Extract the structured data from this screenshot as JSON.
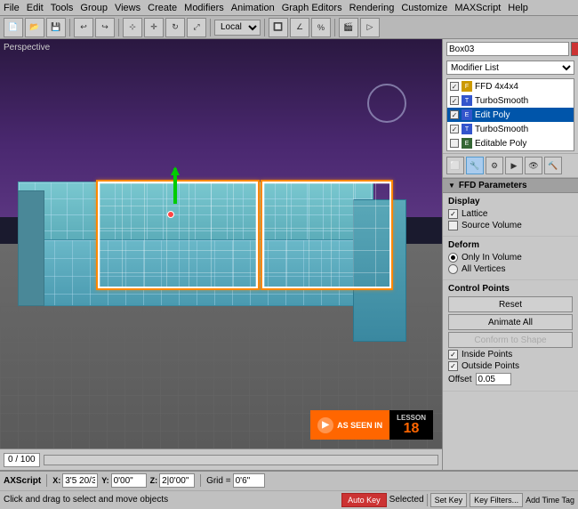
{
  "menu": {
    "items": [
      "File",
      "Edit",
      "Tools",
      "Group",
      "Views",
      "Create",
      "Modifiers",
      "Animation",
      "Graph Editors",
      "Rendering",
      "Customize",
      "MAXScript",
      "Help"
    ]
  },
  "viewport": {
    "label": "Perspective"
  },
  "right_panel": {
    "obj_name": "Box03",
    "modifier_list_label": "Modifier List",
    "stack_items": [
      {
        "name": "FFD 4x4x4",
        "type": "yellow",
        "checked": true,
        "selected": false
      },
      {
        "name": "TurboSmooth",
        "type": "blue",
        "checked": true,
        "selected": false
      },
      {
        "name": "Edit Poly",
        "type": "blue",
        "checked": true,
        "selected": true
      },
      {
        "name": "TurboSmooth",
        "type": "blue",
        "checked": true,
        "selected": false
      },
      {
        "name": "Editable Poly",
        "type": "green",
        "checked": false,
        "selected": false
      }
    ],
    "ffd_params": {
      "title": "FFD Parameters",
      "display_label": "Display",
      "lattice_label": "Lattice",
      "lattice_checked": true,
      "source_volume_label": "Source Volume",
      "source_volume_checked": false,
      "deform_label": "Deform",
      "only_in_volume_label": "Only In Volume",
      "only_in_volume_checked": true,
      "all_vertices_label": "All Vertices",
      "all_vertices_checked": false,
      "control_points_label": "Control Points",
      "reset_label": "Reset",
      "animate_all_label": "Animate All",
      "conform_label": "Conform to Shape",
      "inside_points_label": "Inside Points",
      "inside_points_checked": true,
      "outside_points_label": "Outside Points",
      "outside_points_checked": true,
      "offset_label": "Offset",
      "offset_value": "0.05"
    }
  },
  "status_bar": {
    "counter": "0 / 100",
    "x_label": "X:",
    "x_value": "3'5 20/32\"",
    "y_label": "Y:",
    "y_value": "0'00\"",
    "z_label": "Z:",
    "z_value": "2|0'00\"",
    "grid_label": "Grid =",
    "grid_value": "0'6\"",
    "auto_key": "Auto Key",
    "selected_label": "Selected",
    "set_key": "Set Key",
    "key_filters": "Key Filters...",
    "script_label": "AXScript",
    "hint_text": "Click and drag to select and move objects",
    "time_tag_label": "Add Time Tag"
  },
  "as_seen_in": {
    "label": "AS SEEN IN",
    "lesson_label": "LESSON",
    "lesson_num": "18"
  }
}
